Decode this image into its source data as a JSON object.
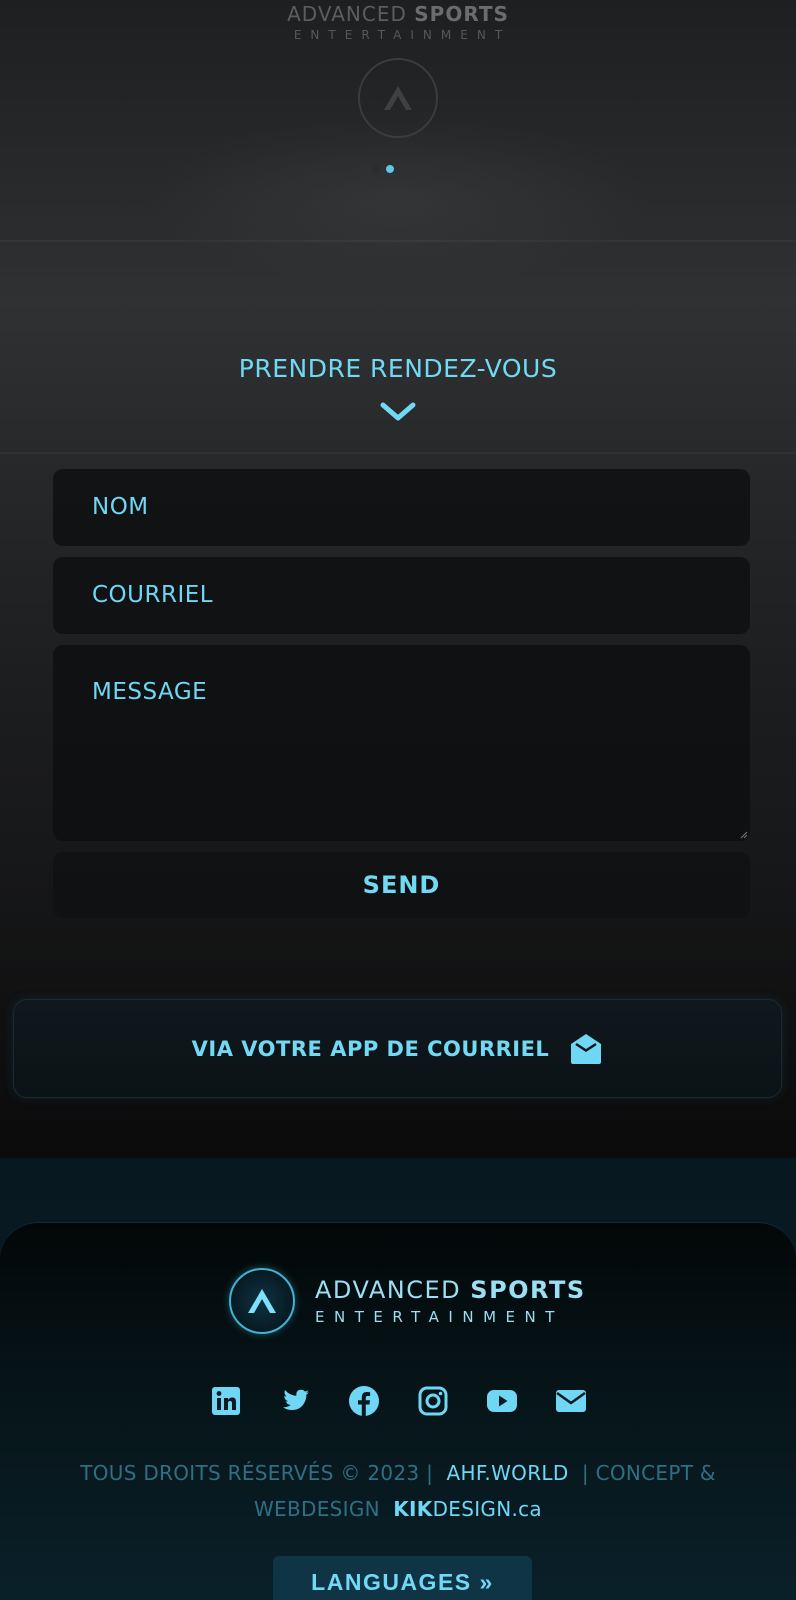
{
  "brand": {
    "line1_regular": "ADVANCED",
    "line1_bold": "SPORTS",
    "line2": "ENTERTAINMENT"
  },
  "slider": {
    "dots": 2,
    "active_index": 1
  },
  "appointment": {
    "title": "PRENDRE RENDEZ-VOUS",
    "name_placeholder": "NOM",
    "email_placeholder": "COURRIEL",
    "message_placeholder": "MESSAGE",
    "send_label": "SEND"
  },
  "mail_app": {
    "label": "VIA VOTRE APP DE COURRIEL",
    "icon": "envelope-open-icon"
  },
  "footer": {
    "socials": [
      "linkedin-icon",
      "twitter-icon",
      "facebook-icon",
      "instagram-icon",
      "youtube-icon",
      "envelope-icon"
    ],
    "rights": "TOUS DROITS RÉSERVÉS © 2023",
    "sep": "|",
    "site_link": "AHF.WORLD",
    "concept": "CONCEPT & WEBDESIGN",
    "kik_bold": "KIK",
    "kik_rest": "DESIGN.ca",
    "languages_label": "LANGUAGES »"
  },
  "colors": {
    "accent": "#6fd6f4",
    "muted": "#2f6f84",
    "footer_bg": "#0a2029"
  }
}
